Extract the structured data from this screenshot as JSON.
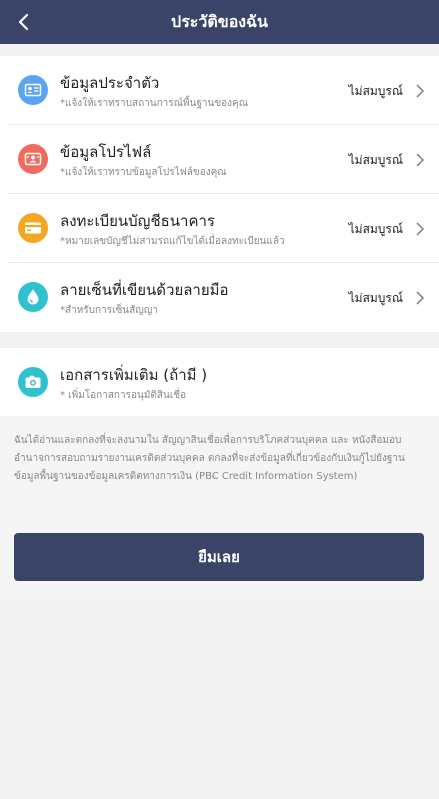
{
  "header": {
    "title": "ประวัติของฉัน"
  },
  "items": [
    {
      "title": "ข้อมูลประจำตัว",
      "subtitle": "*แจ้งให้เราทราบสถานการณ์พื้นฐานของคุณ",
      "status": "ไม่สมบูรณ์",
      "icon": "id-card-icon",
      "color": "#5aa4f0"
    },
    {
      "title": "ข้อมูลโปรไฟล์",
      "subtitle": "*แจ้งให้เราทราบข้อมูลโปรไฟล์ของคุณ",
      "status": "ไม่สมบูรณ์",
      "icon": "profile-card-icon",
      "color": "#ef6b5e"
    },
    {
      "title": "ลงทะเบียนบัญชีธนาคาร",
      "subtitle": "*หมายเลขบัญชีไม่สามรถแก้ไขได้เมื่อลงทะเบียนแล้ว",
      "status": "ไม่สมบูรณ์",
      "icon": "bank-card-icon",
      "color": "#f5a623"
    },
    {
      "title": "ลายเซ็นที่เขียนด้วยลายมือ",
      "subtitle": "*สำหรับการเซ็นสัญญา",
      "status": "ไม่สมบูรณ์",
      "icon": "ink-drop-icon",
      "color": "#2fc1cf"
    }
  ],
  "extra": {
    "title": "เอกสารเพิ่มเติม (ถ้ามี )",
    "subtitle": "* เพิ่มโอกาสการอนุมัติสินเชื่อ",
    "icon": "camera-icon",
    "color": "#2fc1cf"
  },
  "consent": "ฉันได้อ่านและตกลงที่จะลงนามใน สัญญาสินเชื่อเพื่อการบริโภคส่วนบุคคล และ หนังสือมอบอำนาจการสอบถามรายงานเครดิตส่วนบุคคล ตกลงที่จะส่งข้อมูลที่เกี่ยวข้องกับเงินกู้ไปยังฐานข้อมูลพื้นฐานของข้อมูลเครดิตทางการเงิน (PBC Credit Information System)",
  "cta": {
    "label": "ยืมเลย"
  },
  "colors": {
    "header": "#3a4468",
    "cta": "#3a4468"
  }
}
